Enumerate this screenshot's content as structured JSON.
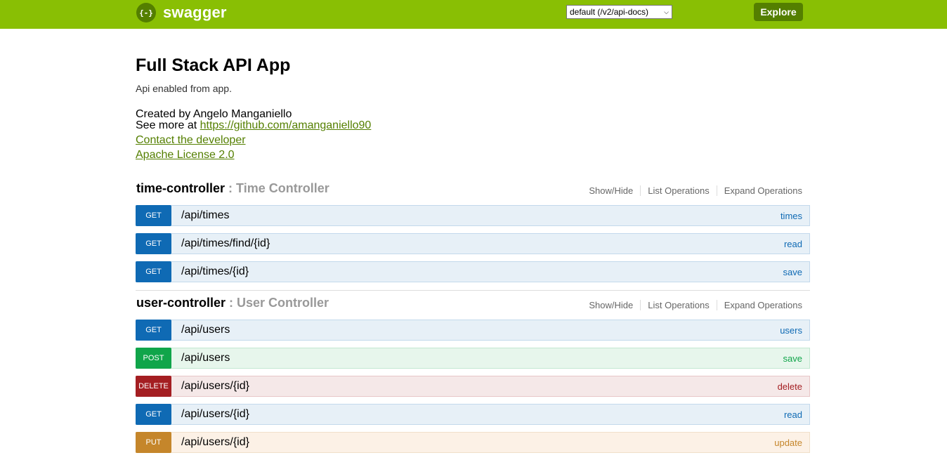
{
  "header": {
    "logo_glyph": "{-}",
    "logo_text": "swagger",
    "spec_select": "default (/v2/api-docs)",
    "explore_label": "Explore",
    "brand_color": "#89bf04"
  },
  "info": {
    "title": "Full Stack API App",
    "description": "Api enabled from app.",
    "created_by": "Created by Angelo Manganiello",
    "see_more_prefix": "See more at ",
    "see_more_link": "https://github.com/amanganiello90",
    "contact_link": "Contact the developer",
    "license_link": "Apache License 2.0"
  },
  "ops_labels": {
    "show_hide": "Show/Hide",
    "list_operations": "List Operations",
    "expand_operations": "Expand Operations"
  },
  "resources": [
    {
      "name": "time-controller",
      "description": " : Time Controller",
      "operations": [
        {
          "method": "GET",
          "path": "/api/times",
          "nickname": "times"
        },
        {
          "method": "GET",
          "path": "/api/times/find/{id}",
          "nickname": "read"
        },
        {
          "method": "GET",
          "path": "/api/times/{id}",
          "nickname": "save"
        }
      ]
    },
    {
      "name": "user-controller",
      "description": " : User Controller",
      "operations": [
        {
          "method": "GET",
          "path": "/api/users",
          "nickname": "users"
        },
        {
          "method": "POST",
          "path": "/api/users",
          "nickname": "save"
        },
        {
          "method": "DELETE",
          "path": "/api/users/{id}",
          "nickname": "delete"
        },
        {
          "method": "GET",
          "path": "/api/users/{id}",
          "nickname": "read"
        },
        {
          "method": "PUT",
          "path": "/api/users/{id}",
          "nickname": "update"
        }
      ]
    }
  ]
}
